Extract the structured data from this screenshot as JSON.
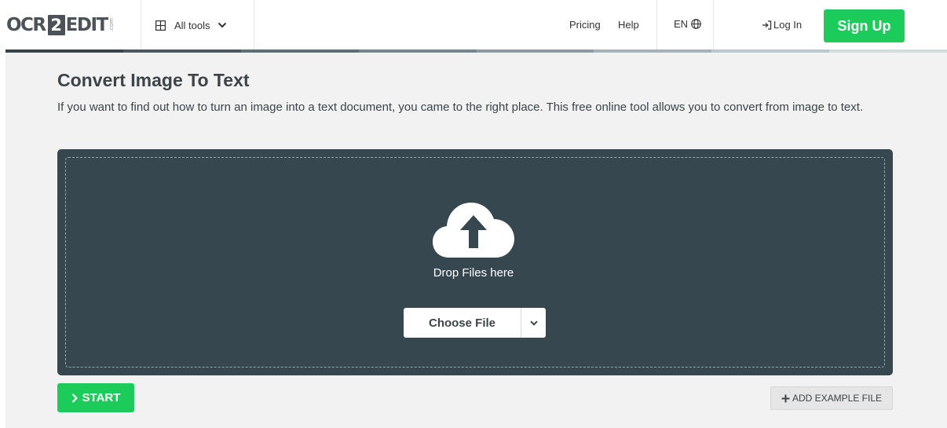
{
  "header": {
    "logo": {
      "left": "OCR",
      "number": "2",
      "right": "EDIT",
      "suffix": ".com"
    },
    "all_tools_label": "All tools",
    "nav": {
      "pricing": "Pricing",
      "help": "Help"
    },
    "language": "EN",
    "login_label": "Log In",
    "signup_label": "Sign Up",
    "stripe_colors": [
      "#38444b",
      "#4b5961",
      "#5f6f78",
      "#76868f",
      "#8d9ca4",
      "#a5b2b8",
      "#bdc8cd",
      "#d3dbde"
    ]
  },
  "main": {
    "title": "Convert Image To Text",
    "description": "If you want to find out how to turn an image into a text document, you came to the right place. This free online tool allows you to convert from image to text.",
    "dropzone": {
      "drop_text": "Drop Files here",
      "choose_file_label": "Choose File"
    },
    "start_label": "START",
    "add_example_label": "ADD EXAMPLE FILE"
  },
  "icons": [
    "grid-icon",
    "chevron-down-icon",
    "globe-icon",
    "login-icon",
    "cloud-upload-icon",
    "chevron-right-icon",
    "plus-icon"
  ],
  "colors": {
    "accent": "#1ccc5b",
    "dropzone_bg": "#36474f",
    "page_bg": "#f2f2f2",
    "text": "#3c4449"
  }
}
